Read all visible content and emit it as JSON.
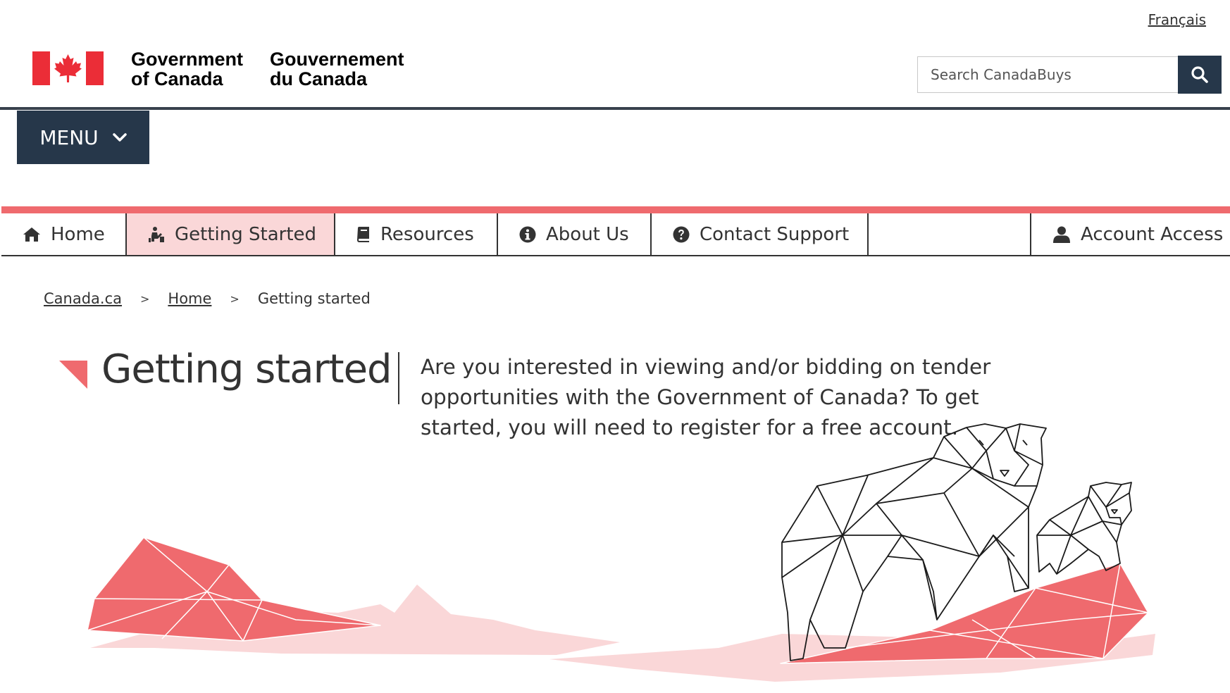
{
  "header": {
    "language_link": "Français",
    "signature_en_line1": "Government",
    "signature_en_line2": "of Canada",
    "signature_fr_line1": "Gouvernement",
    "signature_fr_line2": "du Canada",
    "search_placeholder": "Search CanadaBuys",
    "menu_label": "MENU"
  },
  "nav": {
    "items": [
      {
        "label": "Home",
        "icon": "home-icon"
      },
      {
        "label": "Getting Started",
        "icon": "getting-started-icon",
        "active": true
      },
      {
        "label": "Resources",
        "icon": "book-icon"
      },
      {
        "label": "About Us",
        "icon": "info-icon"
      },
      {
        "label": "Contact Support",
        "icon": "question-icon"
      },
      {
        "label": "Account Access",
        "icon": "user-icon"
      }
    ]
  },
  "breadcrumb": {
    "items": [
      "Canada.ca",
      "Home",
      "Getting started"
    ],
    "separator": ">"
  },
  "hero": {
    "title": "Getting started",
    "intro": "Are you interested in viewing and/or bidding on tender opportunities with the Government of Canada? To get started, you will need to register for a free account."
  },
  "colors": {
    "navy": "#26374a",
    "accent_red": "#ef6a6e",
    "active_tab_bg": "#fad7d8",
    "flag_red": "#eb2d37"
  }
}
